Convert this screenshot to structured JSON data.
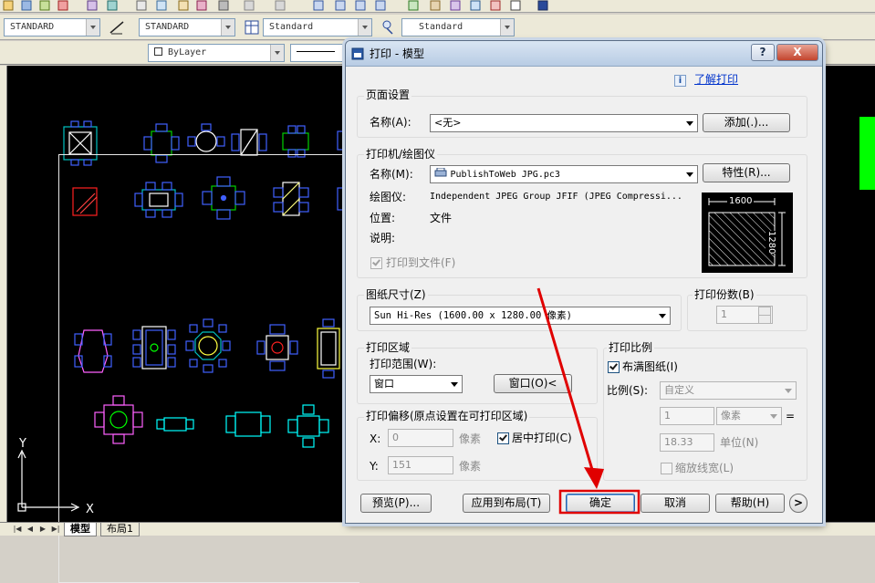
{
  "toolbar": {
    "text_style": "STANDARD",
    "dim_style": "STANDARD",
    "table_style": "Standard",
    "mleader_style": "Standard",
    "layer_color": "ByLayer"
  },
  "tabs": {
    "model": "模型",
    "layout1": "布局1"
  },
  "axis": {
    "x": "X",
    "y": "Y"
  },
  "dialog": {
    "title": "打印 - 模型",
    "help_btn": "?",
    "close_btn": "X",
    "learn_link": "了解打印",
    "page_setup": {
      "group": "页面设置",
      "name_label": "名称(A):",
      "name_value": "<无>",
      "add_button": "添加(.)..."
    },
    "printer": {
      "group": "打印机/绘图仪",
      "name_label": "名称(M):",
      "name_value": "PublishToWeb JPG.pc3",
      "props_button": "特性(R)...",
      "plotter_label": "绘图仪:",
      "plotter_value": "Independent JPEG Group JFIF (JPEG Compressi...",
      "location_label": "位置:",
      "location_value": "文件",
      "desc_label": "说明:",
      "print_to_file": "打印到文件(F)",
      "preview_w": "1600",
      "preview_h": "1280"
    },
    "paper": {
      "group": "图纸尺寸(Z)",
      "value": "Sun Hi-Res (1600.00 x 1280.00 像素)"
    },
    "copies": {
      "group": "打印份数(B)",
      "value": "1"
    },
    "area": {
      "group": "打印区域",
      "range_label": "打印范围(W):",
      "range_value": "窗口",
      "window_button": "窗口(O)<"
    },
    "offset": {
      "group": "打印偏移(原点设置在可打印区域)",
      "x_label": "X:",
      "x_value": "0",
      "x_unit": "像素",
      "y_label": "Y:",
      "y_value": "151",
      "y_unit": "像素",
      "center_label": "居中打印(C)"
    },
    "scale": {
      "group": "打印比例",
      "fit_label": "布满图纸(I)",
      "scale_label": "比例(S):",
      "scale_value": "自定义",
      "val1": "1",
      "unit1": "像素",
      "eq": "=",
      "val2": "18.33",
      "unit2": "单位(N)",
      "lineweight_label": "缩放线宽(L)"
    },
    "buttons": {
      "preview": "预览(P)...",
      "apply_layout": "应用到布局(T)",
      "ok": "确定",
      "cancel": "取消",
      "help": "帮助(H)",
      "more": ">"
    }
  },
  "colors": {
    "highlight": "#e00000",
    "cad_bg": "#000000",
    "dialog_bg": "#f0f0f0"
  }
}
